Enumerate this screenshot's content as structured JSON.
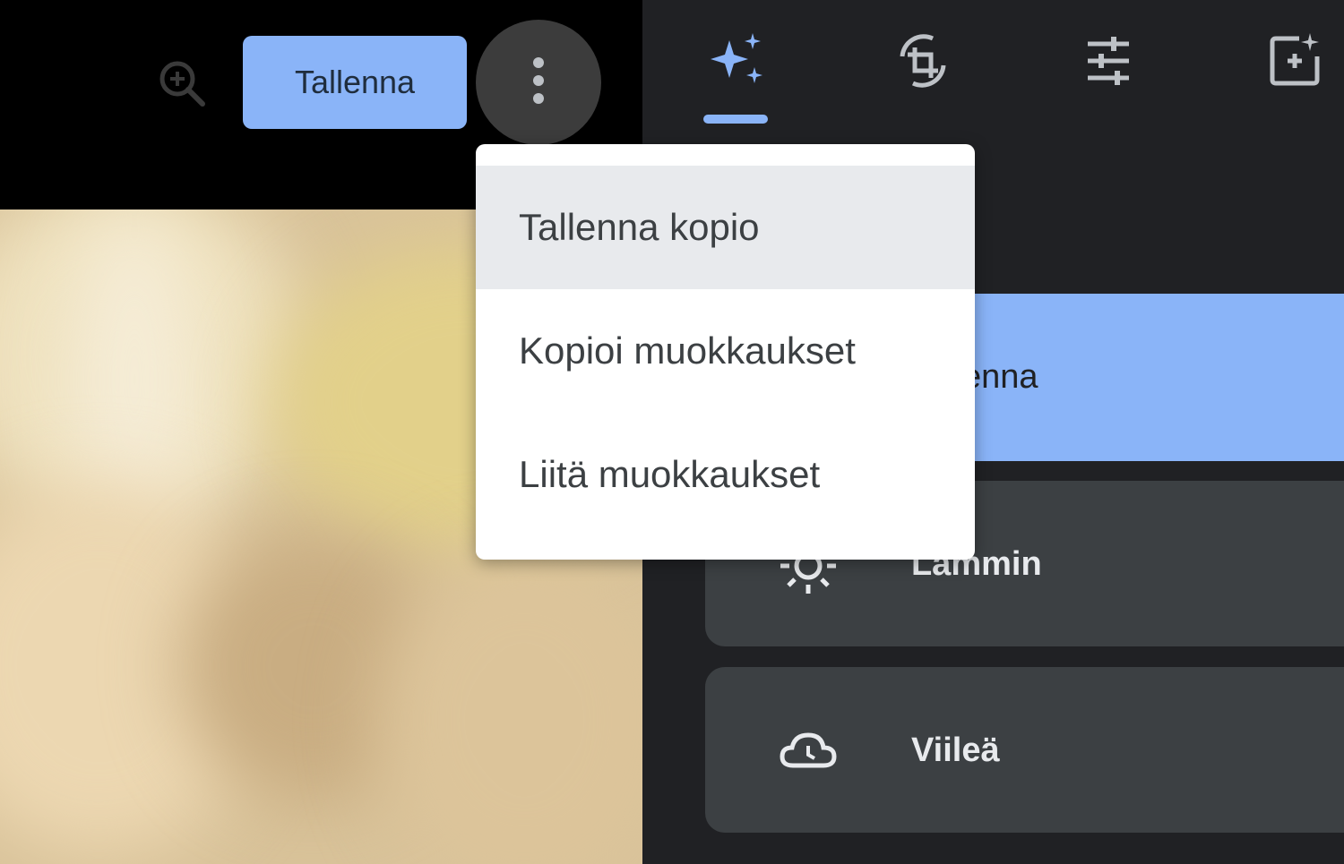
{
  "toolbar": {
    "save_label": "Tallenna",
    "zoom_icon": "zoom-in-icon",
    "more_icon": "more-vert-icon"
  },
  "tabs": [
    {
      "name": "suggestions",
      "icon": "auto-fix-sparkle-icon",
      "active": true
    },
    {
      "name": "crop-rotate",
      "icon": "crop-rotate-icon",
      "active": false
    },
    {
      "name": "adjust",
      "icon": "sliders-tune-icon",
      "active": false
    },
    {
      "name": "filters",
      "icon": "add-photo-sparkle-icon",
      "active": false
    }
  ],
  "filters": {
    "items": [
      {
        "label": "Tallenna",
        "icon": "",
        "selected": true
      },
      {
        "label": "Lämmin",
        "icon": "sun-icon",
        "selected": false
      },
      {
        "label": "Viileä",
        "icon": "cloud-icon",
        "selected": false
      }
    ]
  },
  "menu": {
    "items": [
      {
        "label": "Tallenna kopio",
        "highlighted": true
      },
      {
        "label": "Kopioi muokkaukset",
        "highlighted": false
      },
      {
        "label": "Liitä muokkaukset",
        "highlighted": false
      }
    ]
  },
  "colors": {
    "accent": "#8ab4f8",
    "panel": "#202124",
    "card": "#3c4043"
  }
}
